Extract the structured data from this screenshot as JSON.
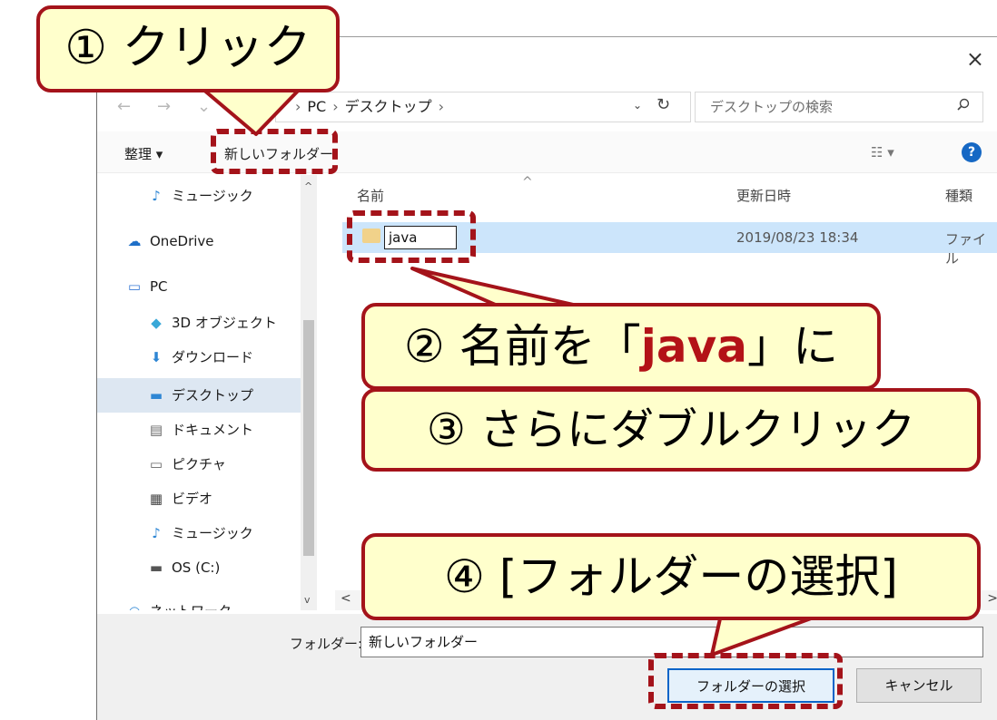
{
  "window": {
    "close_glyph": "×"
  },
  "nav_arrows": {
    "back": "←",
    "forward": "→",
    "down": "⌄",
    "up": "↑"
  },
  "address": {
    "crumbs": [
      "PC",
      "デスクトップ"
    ],
    "separator": "›",
    "dropdown": "⌄",
    "refresh": "↻"
  },
  "search": {
    "placeholder": "デスクトップの検索"
  },
  "toolbar": {
    "organize": "整理 ▾",
    "new_folder": "新しいフォルダー",
    "view": "☷ ▾",
    "help": "?"
  },
  "sidebar": {
    "items": [
      {
        "icon": "♪",
        "label": "ミュージック"
      },
      {
        "icon": "☁",
        "label": "OneDrive"
      },
      {
        "icon": "▭",
        "label": "PC"
      },
      {
        "icon": "◆",
        "label": "3D オブジェクト"
      },
      {
        "icon": "⬇",
        "label": "ダウンロード"
      },
      {
        "icon": "▬",
        "label": "デスクトップ"
      },
      {
        "icon": "▤",
        "label": "ドキュメント"
      },
      {
        "icon": "▭",
        "label": "ピクチャ"
      },
      {
        "icon": "▦",
        "label": "ビデオ"
      },
      {
        "icon": "♪",
        "label": "ミュージック"
      },
      {
        "icon": "▬",
        "label": "OS (C:)"
      },
      {
        "icon": "◒",
        "label": "ネットワーク"
      }
    ],
    "scroll_up": "^",
    "scroll_down": "v"
  },
  "file_list": {
    "columns": [
      "名前",
      "更新日時",
      "種類"
    ],
    "sort_indicator": "^",
    "rows": [
      {
        "name": "java",
        "modified": "2019/08/23 18:34",
        "type": "ファイル"
      }
    ],
    "hscroll_left": "<",
    "hscroll_right": ">"
  },
  "footer": {
    "folder_label": "フォルダー:",
    "folder_value": "新しいフォルダー",
    "select_button": "フォルダーの選択",
    "cancel_button": "キャンセル"
  },
  "annotations": {
    "step1": "① クリック",
    "step2_prefix": "② 名前を「",
    "step2_accent": "java",
    "step2_suffix": "」に",
    "step3": "③ さらにダブルクリック",
    "step4": "④ [フォルダーの選択]"
  },
  "colors": {
    "annotation_red": "#a4131a",
    "callout_fill": "#ffffcc",
    "selection_blue": "#cce5fb",
    "accent_blue": "#0a64c8"
  }
}
